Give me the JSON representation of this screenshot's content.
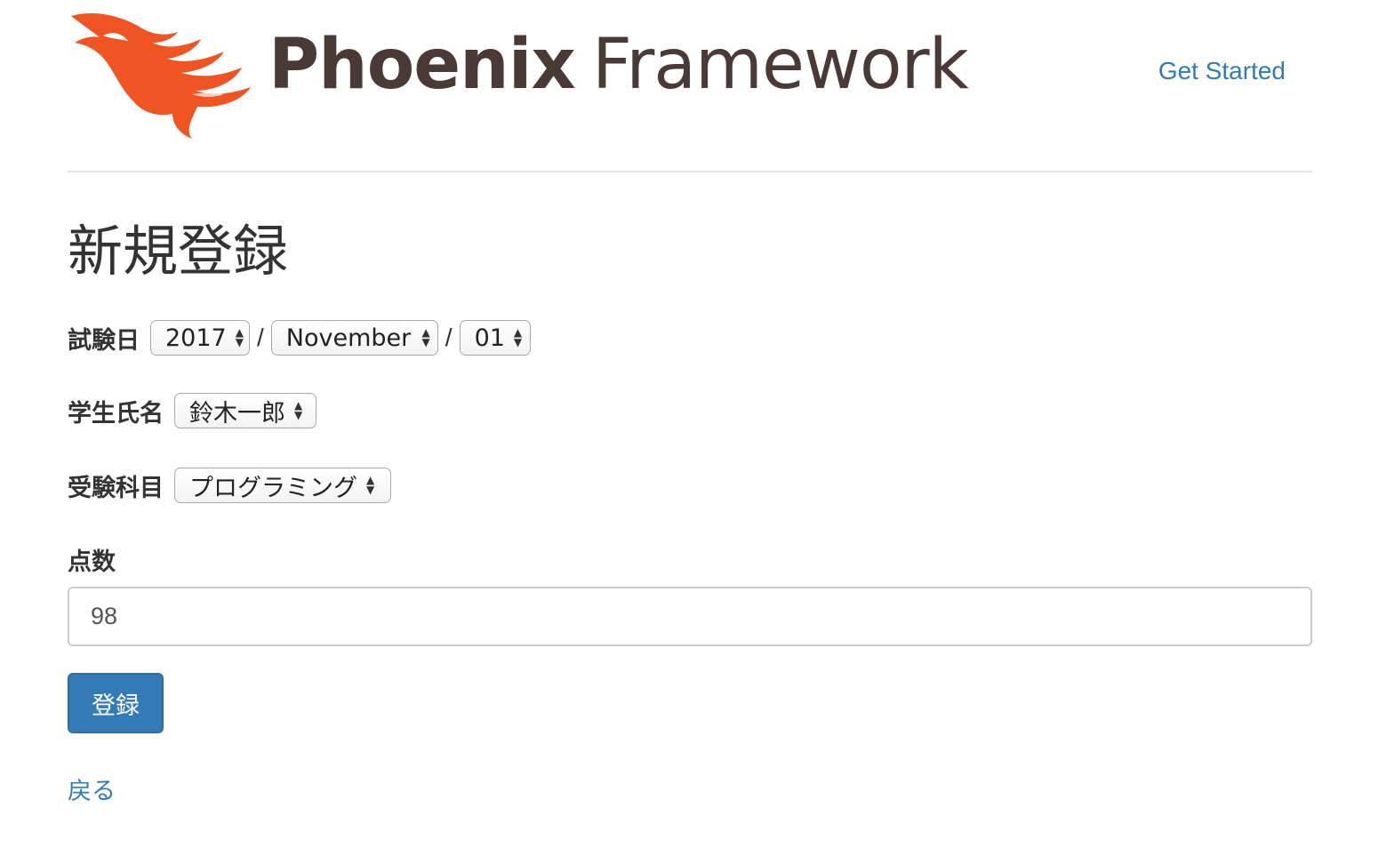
{
  "header": {
    "logo_bold": "Phoenix",
    "logo_light": "Framework",
    "nav_link": "Get Started",
    "brand_color": "#f05423"
  },
  "main": {
    "title": "新規登録",
    "exam_date": {
      "label": "試験日",
      "year": "2017",
      "month": "November",
      "day": "01",
      "separator": "/"
    },
    "student": {
      "label": "学生氏名",
      "value": "鈴木一郎"
    },
    "subject": {
      "label": "受験科目",
      "value": "プログラミング"
    },
    "score": {
      "label": "点数",
      "value": "98"
    },
    "submit_label": "登録",
    "back_label": "戻る"
  },
  "colors": {
    "link": "#337ab7",
    "button": "#337ab7"
  }
}
